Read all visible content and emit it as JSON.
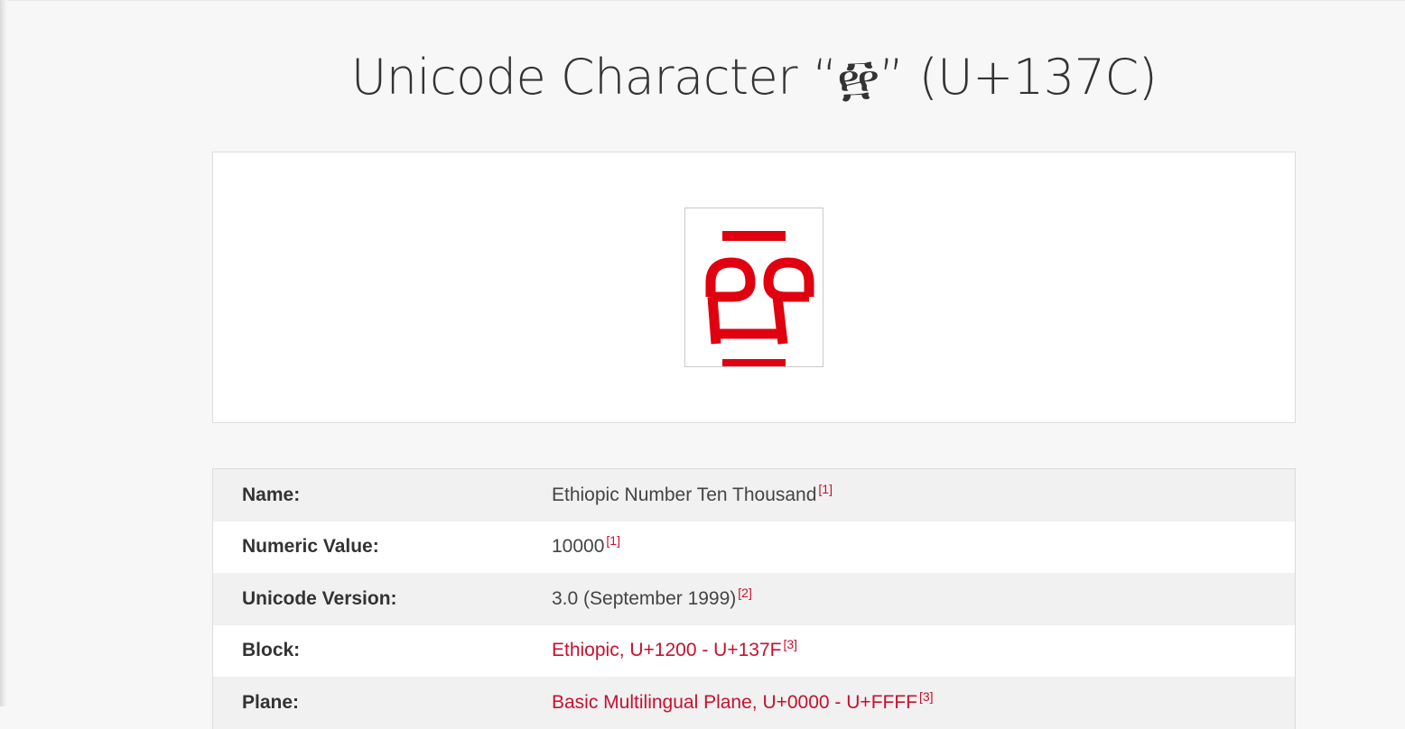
{
  "page": {
    "title": "Unicode Character “፼” (U+137C)"
  },
  "glyph": {
    "character": "፼",
    "color": "#e0000f"
  },
  "properties": [
    {
      "label": "Name:",
      "value": "Ethiopic Number Ten Thousand",
      "ref": "[1]",
      "is_link": false
    },
    {
      "label": "Numeric Value:",
      "value": "10000",
      "ref": "[1]",
      "is_link": false
    },
    {
      "label": "Unicode Version:",
      "value": "3.0 (September 1999)",
      "ref": "[2]",
      "is_link": false
    },
    {
      "label": "Block:",
      "value": "Ethiopic, U+1200 - U+137F",
      "ref": "[3]",
      "is_link": true
    },
    {
      "label": "Plane:",
      "value": "Basic Multilingual Plane, U+0000 - U+FFFF",
      "ref": "[3]",
      "is_link": true
    }
  ],
  "colors": {
    "accent": "#c8102e",
    "background": "#f7f7f7",
    "row_alt": "#f1f1f1"
  }
}
